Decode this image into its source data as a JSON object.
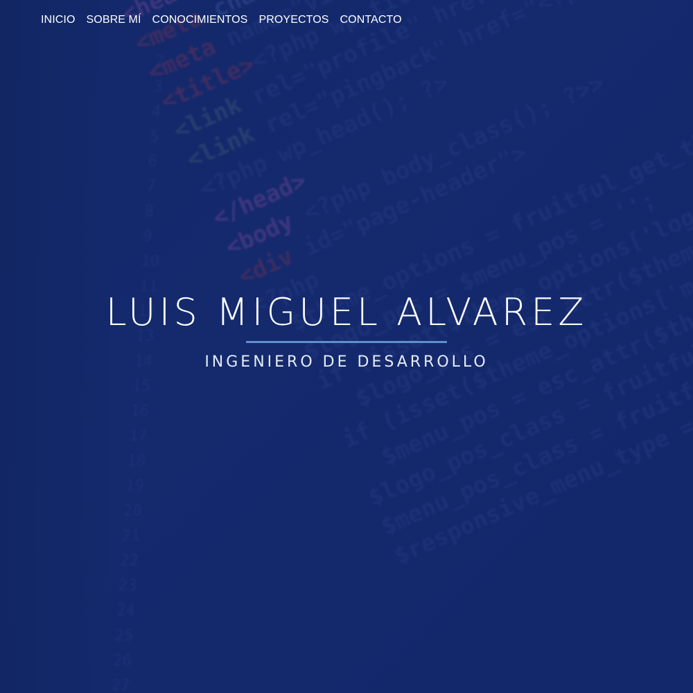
{
  "nav": {
    "items": [
      {
        "label": "INICIO"
      },
      {
        "label": "SOBRE MÍ"
      },
      {
        "label": "CONOCIMIENTOS"
      },
      {
        "label": "PROYECTOS"
      },
      {
        "label": "CONTACTO"
      }
    ]
  },
  "hero": {
    "name": "LUIS MIGUEL ALVAREZ",
    "role": "INGENIERO DE DESARROLLO"
  },
  "colors": {
    "background": "#13296a",
    "accent_line": "#5f8fd0",
    "text": "#ffffff"
  }
}
